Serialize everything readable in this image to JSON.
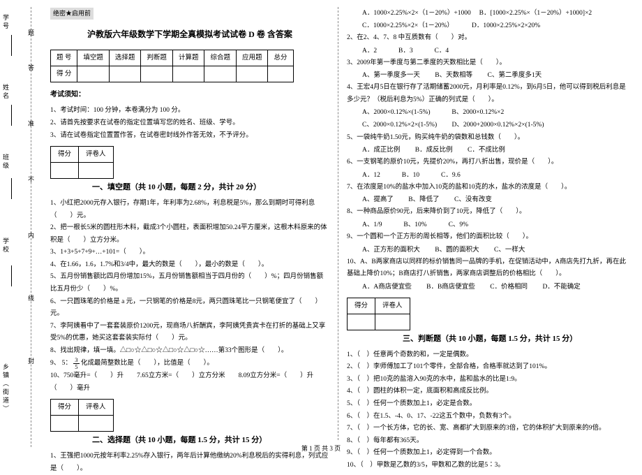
{
  "secret": "绝密★启用前",
  "title": "沪教版六年级数学下学期全真模拟考试试卷 D 卷 含答案",
  "score_table": {
    "headers": [
      "题 号",
      "填空题",
      "选择题",
      "判断题",
      "计算题",
      "综合题",
      "应用题",
      "总分"
    ],
    "row_label": "得 分"
  },
  "notice": {
    "heading": "考试须知：",
    "items": [
      "1、考试时间：100 分钟，本卷满分为 100 分。",
      "2、请首先按要求在试卷的指定位置填写您的姓名、班级、学号。",
      "3、请在试卷指定位置置作答，在试卷密封线外作答无效，不予评分。"
    ]
  },
  "mini": {
    "c1": "得分",
    "c2": "评卷人"
  },
  "sections": {
    "s1": "一、填空题（共 10 小题，每题 2 分，共计 20 分）",
    "s2": "二、选择题（共 10 小题，每题 1.5 分，共计 15 分）",
    "s3": "三、判断题（共 10 小题，每题 1.5 分，共计 15 分）"
  },
  "fill": {
    "q1": "1、小红把2000元存入银行，存期1年，年利率为2.68%，利息税是5%，那么到期时可得利息（　　）元。",
    "q2": "2、把一根长5米的圆柱形木料，截成3个小圆柱，表面积增加50.24平方厘米，这根木料原来的体积是（　　）立方分米。",
    "q3": "3、1+3+5+7+9+…+101=（　　）。",
    "q4": "4、在1.66，1.6，1.7%和3/4中，最大的数是（　　），最小的数是（　　）。",
    "q5": "5、五月份销售额比四月份增加15%，五月份销售额相当于四月份的（　　）%；四月份销售额比五月份少（　　）%。",
    "q6": "6、一只圆珠笔的价格是 a 元，一只钢笔的价格是8元，两只圆珠笔比一只钢笔便宜了（　　）元。",
    "q7": "7、李阿姨看中了一套套装原价1200元，现商场八折酬宾，李阿姨凭贵宾卡在打折的基础上又享受5%的优惠，她买这套套装实际付（　　）元。",
    "q8": "8、找出规律，填一填。△□○☆△□○☆△□○☆△□○☆……第33个图形是（　　）。",
    "q9a": "9、",
    "q9b": "化成最简整数比是（　　），比值是（　　）。",
    "q10": "10、750毫升=（　　）升　　7.65立方米=（　　）立方分米　　8.09立方分米=（　　）升（　　）毫升"
  },
  "choice": {
    "q1": "1、王强把1000元按年利率2.25%存入银行，两年后计算他缴纳20%利息税后的实得利息，列式应是（　　）。",
    "q1o": {
      "a": "A．1000×2.25%×2×（1－20%）+1000",
      "b": "B．[1000×2.25%×（1－20%）+1000]×2",
      "c": "C．1000×2.25%×2×（1－20%）",
      "d": "D．1000×2.25%×2×20%"
    },
    "q2": "2、在2、4、7、8 中互质数有（　　）对。",
    "q2o": {
      "a": "A．2",
      "b": "B．3",
      "c": "C．4"
    },
    "q3": "3、2009年第一季度与第二季度的天数相比是（　　）。",
    "q3o": {
      "a": "A、第一季度多一天",
      "b": "B、天数相等",
      "c": "C、第二季度多1天"
    },
    "q4": "4、王宏4月5日在银行存了活期储蓄2000元，月利率是0.12%，到6月5日，他可以得到税后利息是多少元？（税后利息为5%）正确的列式是（　　）。",
    "q4o": {
      "a": "A、2000×0.12%×(1-5%)",
      "b": "B、2000×0.12%×2",
      "c": "C、2000×0.12%×2×(1-5%)",
      "d": "D、2000+2000×0.12%×2×(1-5%)"
    },
    "q5": "5、一袋纯牛奶1.50元，购买纯牛奶的袋数和总钱数（　　）。",
    "q5o": {
      "a": "A．成正比例",
      "b": "B．成反比例",
      "c": "C．不成比例"
    },
    "q6": "6、一支钢笔的原价10元，先提价20%，再打八折出售，现价是（　　）。",
    "q6o": {
      "a": "A．12",
      "b": "B．10",
      "c": "C．9.6"
    },
    "q7": "7、在浓度是10%的盐水中加入10克的盐和10克的水，盐水的浓度是（　　）。",
    "q7o": {
      "a": "A、提高了",
      "b": "B、降低了",
      "c": "C、没有改变"
    },
    "q8": "8、一种商品原价90元，后来降价到了10元，降低了（　　）。",
    "q8o": {
      "a": "A、1/9",
      "b": "B、10%",
      "c": "C、9%"
    },
    "q9": "9、一个圆和一个正方形的周长相等，他们的面积比较（　　）。",
    "q9o": {
      "a": "A、正方形的面积大",
      "b": "B、圆的面积大",
      "c": "C、一样大"
    },
    "q10": "10、A、B两家商店以同样的标价销售同一品牌的手机，在促销活动中，A商店先打九折，再在此基础上降价10%；B商店打八折销售，两家商店调整后的价格相比（　　）。",
    "q10o": {
      "a": "A．A商店便宜些",
      "b": "B．B商店便宜些",
      "c": "C．价格相同",
      "d": "D．不能确定"
    }
  },
  "judge": {
    "q1": "1、（　）任意两个奇数的和，一定是偶数。",
    "q2": "2、（　）李师傅加工了101个零件，全部合格，合格率就达到了101%。",
    "q3": "3、（　）把10克的盐溶入90克的水中，盐和盐水的比是1:9。",
    "q4": "4、（　）圆柱的体积一定，底面积和高成反比例。",
    "q5": "5、（　）任何一个质数加上1，必定是合数。",
    "q6": "6、（　）在1.5、-4、0、17、-22这五个数中，负数有3个。",
    "q7": "7、（　）一个长方体，它的长、宽、高都扩大到原来的3倍，它的体积扩大到原来的9倍。",
    "q8": "8、（　）每年都有365天。",
    "q9": "9、（　）任何一个质数加上1，必定得到一个合数。",
    "q10": "10、（　）甲数是乙数的3/5，甲数和乙数的比是5∶3。"
  },
  "binding": {
    "labels": {
      "school": "学校",
      "class": "班级",
      "name": "姓名",
      "id": "学号",
      "town": "乡镇（街道）"
    },
    "inner": {
      "seal": "封",
      "line": "线",
      "inside": "内",
      "no": "不",
      "allow": "准",
      "ans": "答",
      "ti": "题"
    }
  },
  "frac": {
    "n": "3",
    "d": "5",
    "pre": "5："
  },
  "footer": "第 1 页 共 3 页"
}
